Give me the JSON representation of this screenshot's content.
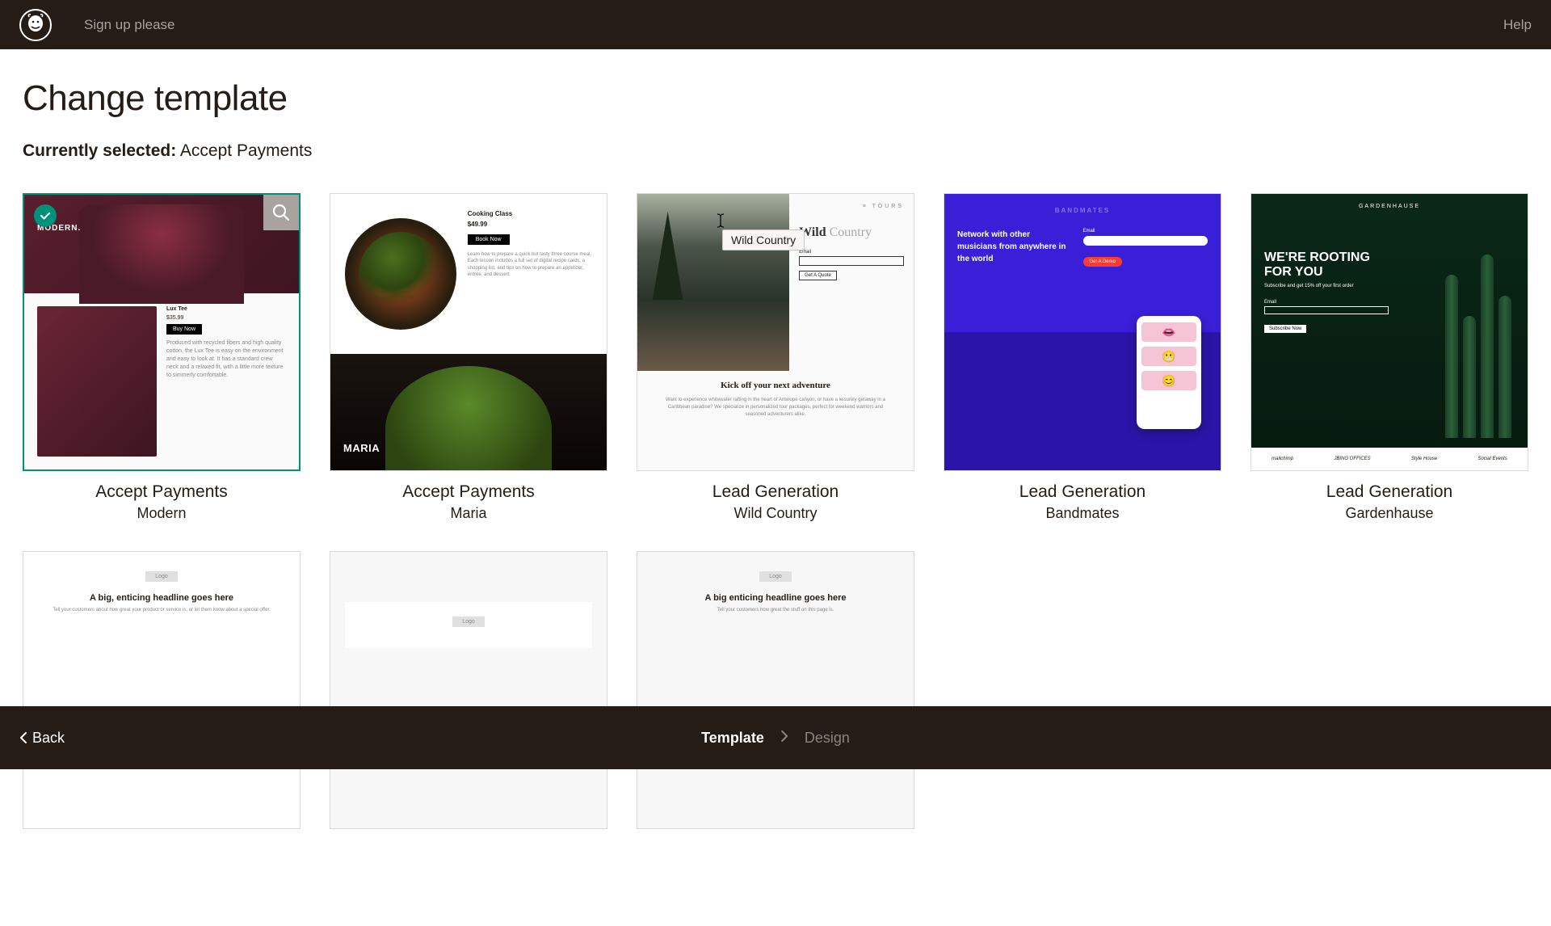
{
  "header": {
    "title": "Sign up please",
    "help": "Help"
  },
  "page": {
    "title": "Change template",
    "selected_label": "Currently selected:",
    "selected_value": "Accept Payments"
  },
  "tooltip": "Wild Country",
  "templates": [
    {
      "category": "Accept Payments",
      "name": "Modern",
      "selected": true,
      "thumb_type": "modern",
      "art": {
        "logo": "MODERN.",
        "product": "Lux Tee",
        "price": "$35.99",
        "btn": "Buy Now",
        "desc": "Produced with recycled fibers and high quality cotton, the Lux Tee is easy on the environment and easy to look at. It has a standard crew neck and a relaxed fit, with a little more texture to simmerly comfortable."
      }
    },
    {
      "category": "Accept Payments",
      "name": "Maria",
      "selected": false,
      "thumb_type": "maria",
      "art": {
        "title": "Cooking Class",
        "price": "$49.99",
        "btn": "Book Now",
        "desc": "Learn how to prepare a quick but tasty three course meal. Each lesson includes a full set of digital recipe cards, a shopping list, and tips on how to prepare an appetizer, entrée, and dessert.",
        "brand": "MARIA"
      }
    },
    {
      "category": "Lead Generation",
      "name": "Wild Country",
      "selected": false,
      "thumb_type": "wild",
      "art": {
        "tours": "≡  TOURS",
        "headline_a": "Wild",
        "headline_b": "Country",
        "email": "Email",
        "btn": "Get A Quote",
        "sub_h": "Kick off your next adventure",
        "sub_p": "Want to experience whitewater rafting in the heart of Antelope canyon, or have a leisurely getaway in a Caribbean paradise? We specialize in personalized tour packages, perfect for weekend warriors and seasoned adventurers alike."
      }
    },
    {
      "category": "Lead Generation",
      "name": "Bandmates",
      "selected": false,
      "thumb_type": "band",
      "art": {
        "logo": "BANDMATES",
        "text": "Network with other musicians from anywhere in the world",
        "email": "Email",
        "btn": "Get A Demo"
      }
    },
    {
      "category": "Lead Generation",
      "name": "Gardenhause",
      "selected": false,
      "thumb_type": "garden",
      "art": {
        "logo": "GARDENHAUSE",
        "headline": "WE'RE ROOTING FOR YOU",
        "sub": "Subscribe and get 15% off your first order",
        "email": "Email",
        "btn": "Subscribe Now",
        "foot": [
          "mailchimp",
          "JBING OFFICES",
          "Style House",
          "Social Events"
        ]
      }
    },
    {
      "category": "",
      "name": "",
      "selected": false,
      "thumb_type": "generic_white",
      "art": {
        "logo": "Logo",
        "headline": "A big, enticing headline goes here",
        "sub": "Tell your customers about how great your product or service is, or let them know about a special offer."
      }
    },
    {
      "category": "",
      "name": "",
      "selected": false,
      "thumb_type": "generic_box",
      "art": {
        "logo": "Logo"
      }
    },
    {
      "category": "",
      "name": "",
      "selected": false,
      "thumb_type": "generic_gray",
      "art": {
        "logo": "Logo",
        "headline": "A big enticing headline goes here",
        "sub": "Tell your customers how great the stuff on this page is."
      }
    }
  ],
  "footer": {
    "back": "Back",
    "step1": "Template",
    "step2": "Design"
  }
}
